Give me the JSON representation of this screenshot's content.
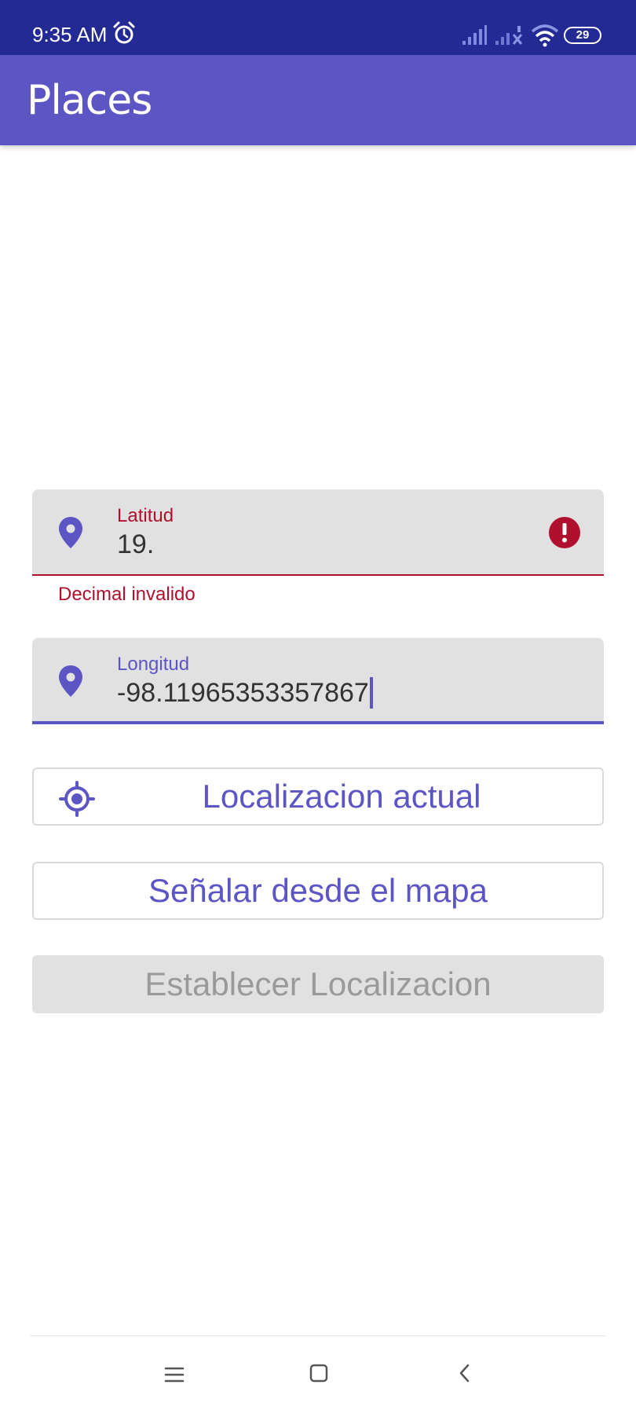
{
  "status_bar": {
    "time": "9:35 AM",
    "battery": "29",
    "icons": [
      "alarm-icon",
      "signal-icon",
      "signal-icon",
      "wifi-icon",
      "battery-icon"
    ]
  },
  "app_bar": {
    "title": "Places"
  },
  "latitude_field": {
    "label": "Latitud",
    "value": "19.",
    "error": "Decimal invalido",
    "icon": "location-pin-icon",
    "error_icon": "error-icon"
  },
  "longitude_field": {
    "label": "Longitud",
    "value": "-98.11965353357867",
    "icon": "location-pin-icon"
  },
  "buttons": {
    "current_location": "Localizacion actual",
    "pick_on_map": "Señalar desde el mapa",
    "set_location": "Establecer Localizacion"
  },
  "navigation_bar": {
    "icons": [
      "menu-icon",
      "home-icon",
      "back-icon"
    ]
  },
  "colors": {
    "status_bar": "#232a94",
    "primary": "#5c55c4",
    "error": "#b0102e",
    "field_background": "#e1e1e1",
    "disabled_text": "#9a9a9a"
  }
}
